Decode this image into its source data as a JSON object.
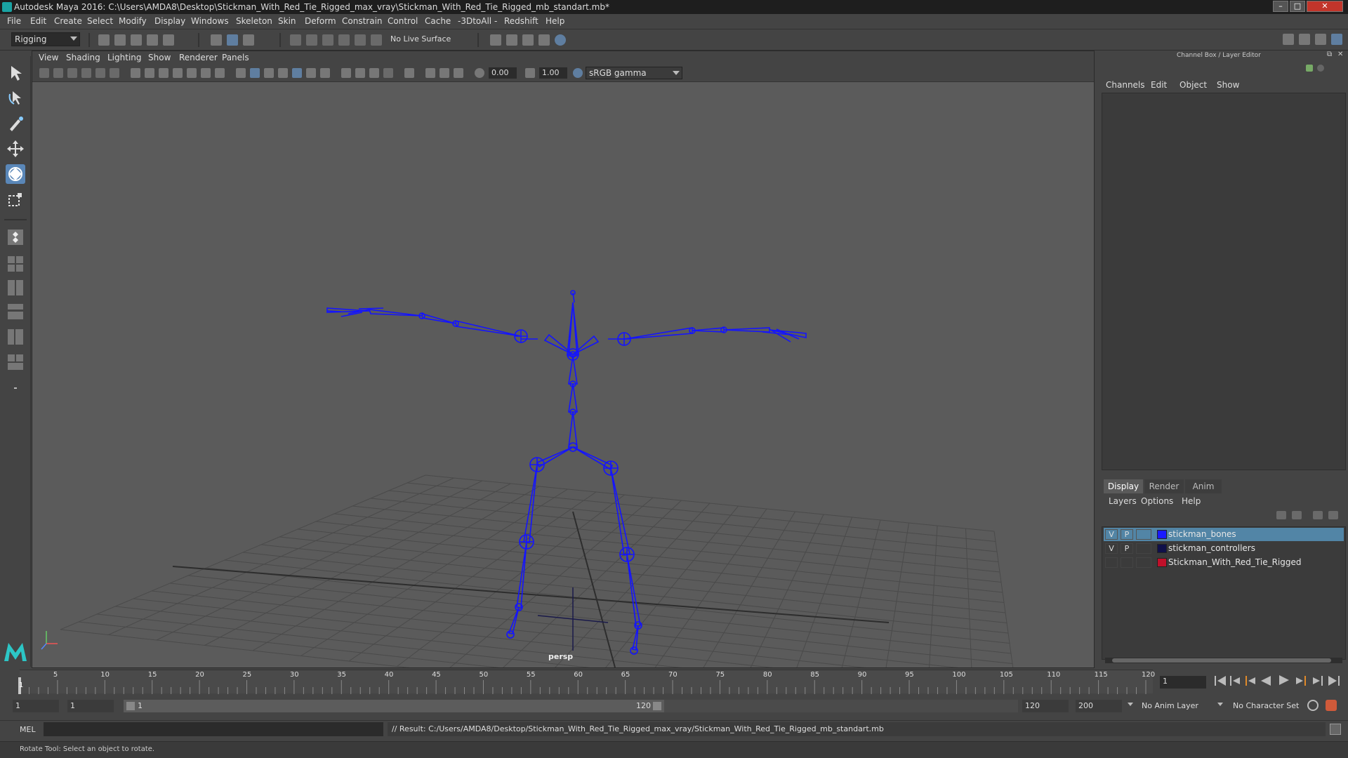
{
  "titlebar": {
    "title": "Autodesk Maya 2016: C:\\Users\\AMDA8\\Desktop\\Stickman_With_Red_Tie_Rigged_max_vray\\Stickman_With_Red_Tie_Rigged_mb_standart.mb*"
  },
  "menubar": {
    "items": [
      "File",
      "Edit",
      "Create",
      "Select",
      "Modify",
      "Display",
      "Windows",
      "Skeleton",
      "Skin",
      "Deform",
      "Constrain",
      "Control",
      "Cache",
      "-3DtoAll -",
      "Redshift",
      "Help"
    ]
  },
  "shelf": {
    "mode": "Rigging",
    "live_surface": "No Live Surface"
  },
  "viewport": {
    "menus": [
      "View",
      "Shading",
      "Lighting",
      "Show",
      "Renderer",
      "Panels"
    ],
    "exposure": "0.00",
    "gamma": "1.00",
    "color_space": "sRGB gamma",
    "camera_label": "persp"
  },
  "right_panel": {
    "header": "Channel Box / Layer Editor",
    "channel_menus": [
      "Channels",
      "Edit",
      "Object",
      "Show"
    ],
    "layer_tabs": [
      "Display",
      "Render",
      "Anim"
    ],
    "layer_menus": [
      "Layers",
      "Options",
      "Help"
    ],
    "layers": [
      {
        "v": "V",
        "p": "P",
        "name": "stickman_bones",
        "color": "#1a1aff"
      },
      {
        "v": "V",
        "p": "P",
        "name": "stickman_controllers",
        "color": "#10104a"
      },
      {
        "v": "",
        "p": "",
        "name": "Stickman_With_Red_Tie_Rigged",
        "color": "#c0102a"
      }
    ]
  },
  "timeline": {
    "ticks": [
      "5",
      "10",
      "15",
      "20",
      "25",
      "30",
      "35",
      "40",
      "45",
      "50",
      "55",
      "60",
      "65",
      "70",
      "75",
      "80",
      "85",
      "90",
      "95",
      "100",
      "105",
      "110",
      "115",
      "120"
    ],
    "start_tick": "1",
    "end_tick": "120",
    "current_frame": "1"
  },
  "range": {
    "start": "1",
    "playback_start": "1",
    "slider_start": "1",
    "slider_end": "120",
    "playback_end": "120",
    "end": "200",
    "anim_layer": "No Anim Layer",
    "char_set": "No Character Set"
  },
  "command": {
    "lang": "MEL",
    "result": "// Result: C:/Users/AMDA8/Desktop/Stickman_With_Red_Tie_Rigged_max_vray/Stickman_With_Red_Tie_Rigged_mb_standart.mb"
  },
  "help_line": "Rotate Tool: Select an object to rotate.",
  "colors": {
    "accent": "#5285a6",
    "bones": "#1414ff"
  }
}
